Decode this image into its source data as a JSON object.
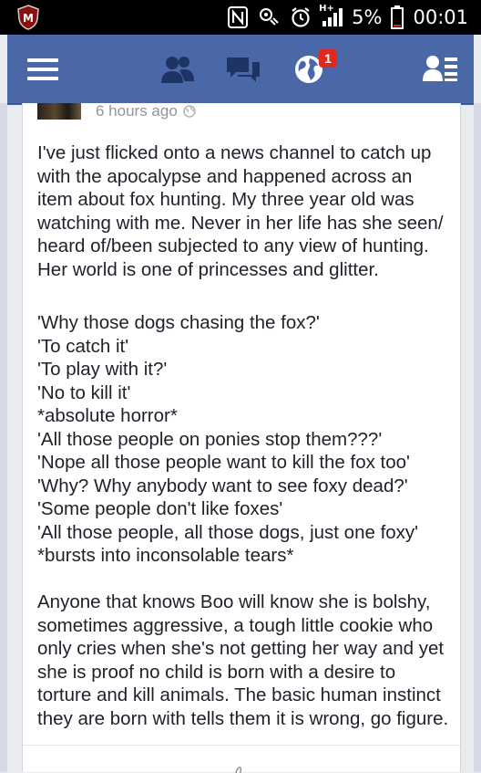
{
  "status_bar": {
    "network_label": "H+",
    "battery_percent": "5%",
    "time": "00:01"
  },
  "nav": {
    "notification_count": "1",
    "icons": [
      "menu-icon",
      "friend-requests-icon",
      "messages-icon",
      "notifications-globe-icon",
      "contacts-list-icon"
    ]
  },
  "post": {
    "timestamp": "6 hours ago",
    "paragraph1": "I've just flicked onto a news channel to catch up\nwith the apocalypse and happened across an\nitem about fox hunting. My three year old was\nwatching with me. Never in her life has she seen/\nheard of/been subjected to any view of hunting.\nHer world is one of princesses and glitter.",
    "paragraph2": "'Why those dogs chasing the fox?'\n'To catch it'\n'To play with it?'\n'No to kill it'\n*absolute horror*\n'All those people on ponies stop them???'\n'Nope all those people want to kill the fox too'\n'Why? Why anybody want to see foxy dead?'\n'Some people don't like foxes'\n'All those people, all those dogs, just one foxy'\n*bursts into inconsolable tears*",
    "paragraph3": "Anyone that knows Boo will know she is bolshy,\nsometimes aggressive, a tough little cookie who\nonly cries when she's not getting her way and yet\nshe is proof no child is born with a desire to\ntorture and kill animals. The basic human instinct\nthey are born with tells them it is wrong, go figure."
  },
  "colors": {
    "nav_blue": "#4a67a7",
    "badge_red": "#e0281e",
    "text_dark": "#1d2129",
    "muted": "#90949c"
  }
}
